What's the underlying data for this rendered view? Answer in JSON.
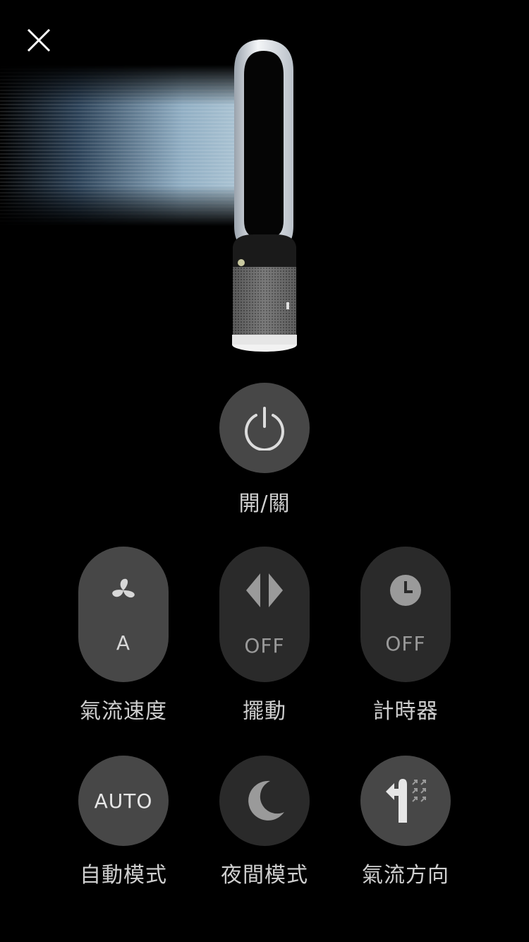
{
  "power": {
    "label": "開/關"
  },
  "controls": [
    {
      "label": "氣流速度",
      "value": "A"
    },
    {
      "label": "擺動",
      "value": "OFF"
    },
    {
      "label": "計時器",
      "value": "OFF"
    }
  ],
  "modes": [
    {
      "label": "自動模式",
      "value": "AUTO"
    },
    {
      "label": "夜間模式"
    },
    {
      "label": "氣流方向"
    }
  ],
  "icons": {
    "close": "close-icon",
    "power": "power-icon",
    "fan": "fan-icon",
    "oscillation": "oscillation-icon",
    "timer": "clock-icon",
    "night": "moon-icon",
    "direction": "airflow-direction-icon"
  },
  "colors": {
    "background": "#000000",
    "button": "#474747",
    "button_dark": "#2a2a2a",
    "label": "#cfcfcf"
  }
}
